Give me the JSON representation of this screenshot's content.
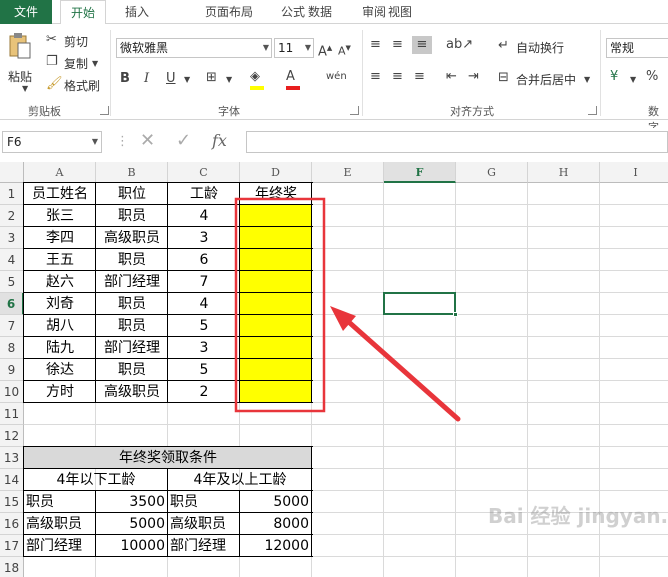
{
  "tabs": [
    "文件",
    "开始",
    "插入",
    "页面布局",
    "公式",
    "数据",
    "审阅",
    "视图"
  ],
  "clipboard": {
    "paste": "粘贴",
    "cut": "剪切",
    "copy": "复制",
    "format_painter": "格式刷",
    "group": "剪贴板"
  },
  "font": {
    "name": "微软雅黑",
    "size": "11",
    "bold": "B",
    "italic": "I",
    "underline": "U",
    "group": "字体"
  },
  "alignment": {
    "wrap": "自动换行",
    "merge": "合并后居中",
    "group": "对齐方式"
  },
  "number": {
    "format": "常规",
    "group_partial": "数字"
  },
  "formula_bar": {
    "name_box": "F6",
    "fx": "fx"
  },
  "columns": [
    "A",
    "B",
    "C",
    "D",
    "E",
    "F",
    "G",
    "H",
    "I"
  ],
  "rows": [
    "1",
    "2",
    "3",
    "4",
    "5",
    "6",
    "7",
    "8",
    "9",
    "10",
    "11",
    "12",
    "13",
    "14",
    "15",
    "16",
    "17",
    "18"
  ],
  "selected": {
    "column": "F",
    "row": "6"
  },
  "table1": {
    "header": [
      "员工姓名",
      "职位",
      "工龄",
      "年终奖"
    ],
    "rows": [
      [
        "张三",
        "职员",
        "4"
      ],
      [
        "李四",
        "高级职员",
        "3"
      ],
      [
        "王五",
        "职员",
        "6"
      ],
      [
        "赵六",
        "部门经理",
        "7"
      ],
      [
        "刘奇",
        "职员",
        "4"
      ],
      [
        "胡八",
        "职员",
        "5"
      ],
      [
        "陆九",
        "部门经理",
        "3"
      ],
      [
        "徐达",
        "职员",
        "5"
      ],
      [
        "方时",
        "高级职员",
        "2"
      ]
    ]
  },
  "table2": {
    "title": "年终奖领取条件",
    "sub1": "4年以下工龄",
    "sub2": "4年及以上工龄",
    "rows": [
      [
        "职员",
        "3500",
        "职员",
        "5000"
      ],
      [
        "高级职员",
        "5000",
        "高级职员",
        "8000"
      ],
      [
        "部门经理",
        "10000",
        "部门经理",
        "12000"
      ]
    ]
  },
  "colors": {
    "accent": "#217346",
    "highlight": "#ffff00",
    "annotation": "#e8353b"
  },
  "watermark": "Bai 经验 jingyan.baidu.com"
}
